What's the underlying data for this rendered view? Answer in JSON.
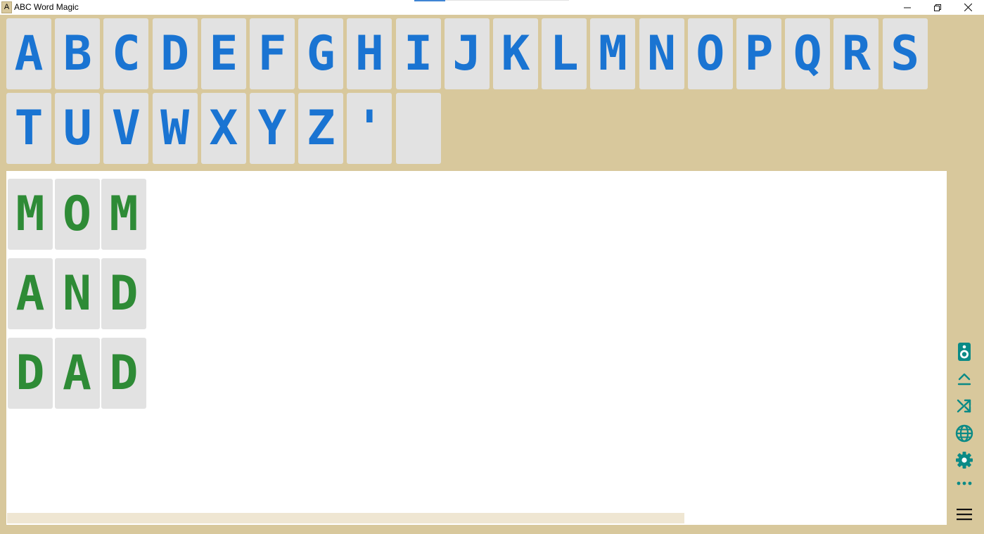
{
  "window": {
    "title": "ABC Word Magic",
    "icon_letter": "A",
    "minimize_icon": "minimize-icon",
    "restore_icon": "restore-icon",
    "close_icon": "close-icon"
  },
  "palette": {
    "row1": [
      "A",
      "B",
      "C",
      "D",
      "E",
      "F",
      "G",
      "H",
      "I",
      "J",
      "K",
      "L",
      "M",
      "N",
      "O",
      "P",
      "Q",
      "R",
      "S"
    ],
    "row2": [
      "T",
      "U",
      "V",
      "W",
      "X",
      "Y",
      "Z",
      "'",
      ""
    ]
  },
  "words": [
    [
      "M",
      "O",
      "M"
    ],
    [
      "A",
      "N",
      "D"
    ],
    [
      "D",
      "A",
      "D"
    ]
  ],
  "toolbar": {
    "speaker": "speaker-icon",
    "collapse": "chevron-up-icon",
    "shuffle": "shuffle-icon",
    "language": "globe-icon",
    "settings": "gear-icon",
    "more": "more-icon",
    "menu": "hamburger-icon"
  },
  "colors": {
    "background": "#d8c89c",
    "tile": "#e2e2e2",
    "palette_letter": "#1a74d2",
    "word_letter": "#2e8b36",
    "toolbar_icon": "#0a8a86"
  }
}
